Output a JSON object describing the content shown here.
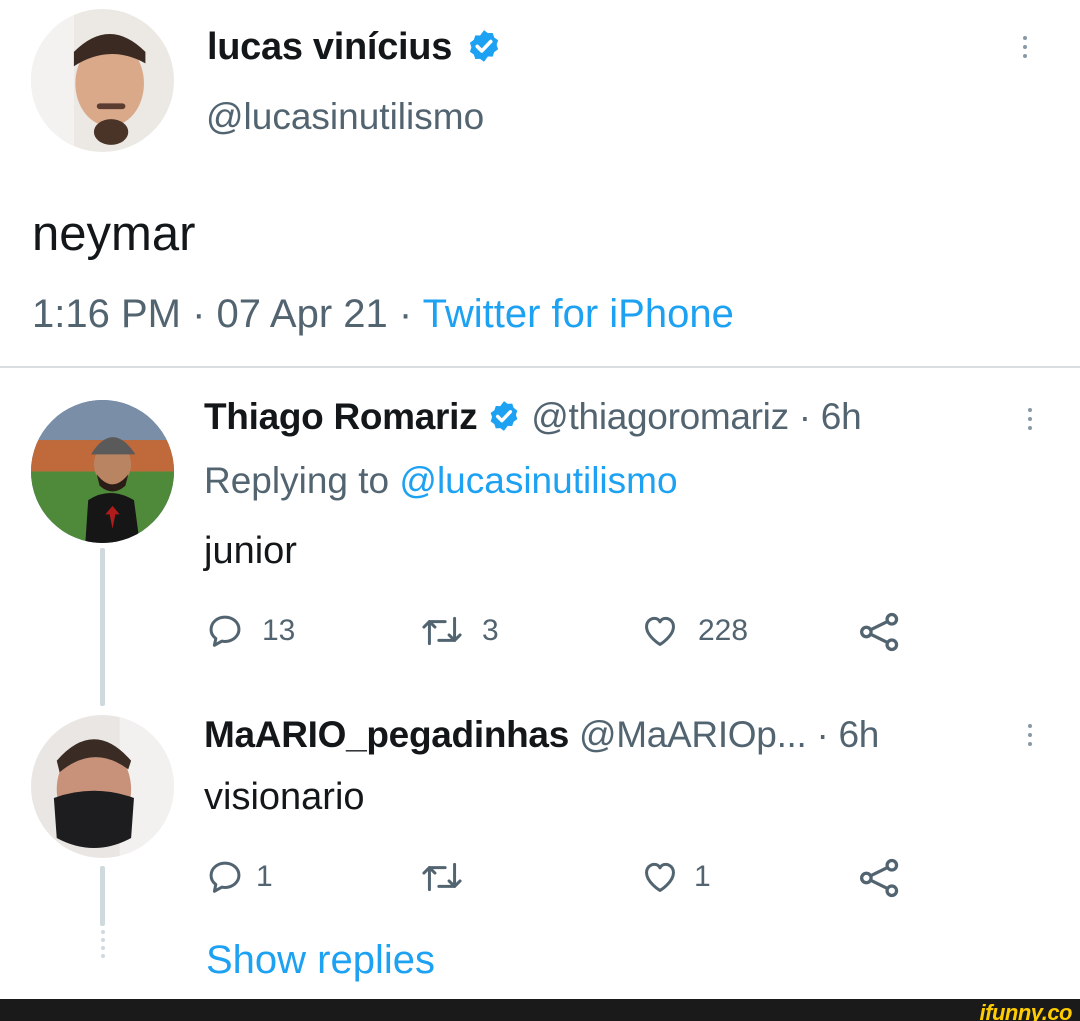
{
  "main_tweet": {
    "name": "lucas vinícius",
    "handle": "@lucasinutilismo",
    "text": "neymar",
    "time": "1:16 PM",
    "date": "07 Apr 21",
    "source": "Twitter for iPhone",
    "separator": " · "
  },
  "replies": [
    {
      "name": "Thiago Romariz",
      "handle": "@thiagoromariz",
      "age": " · 6h",
      "replying_prefix": "Replying to ",
      "replying_to": "@lucasinutilismo",
      "text": "junior",
      "replies": "13",
      "retweets": "3",
      "likes": "228"
    },
    {
      "name": "MaARIO_pegadinhas",
      "handle": "@MaARIOp...",
      "age": " · 6h",
      "text": "visionario",
      "replies": "1",
      "retweets": "",
      "likes": "1"
    }
  ],
  "show_replies": "Show replies",
  "watermark": "ifunny.co",
  "icons": [
    "verified-badge-icon",
    "more-options-icon",
    "reply-icon",
    "retweet-icon",
    "like-icon",
    "share-icon"
  ],
  "colors": {
    "accent": "#1da1f2",
    "muted": "#536471",
    "text": "#14171a"
  }
}
